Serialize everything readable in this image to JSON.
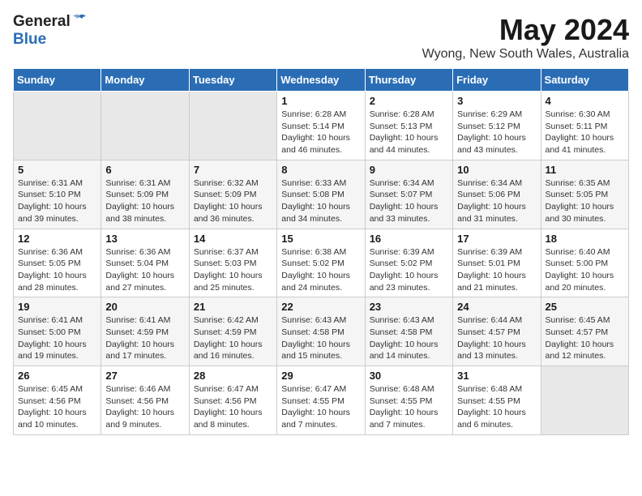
{
  "header": {
    "logo_general": "General",
    "logo_blue": "Blue",
    "month_year": "May 2024",
    "location": "Wyong, New South Wales, Australia"
  },
  "calendar": {
    "days_of_week": [
      "Sunday",
      "Monday",
      "Tuesday",
      "Wednesday",
      "Thursday",
      "Friday",
      "Saturday"
    ],
    "weeks": [
      [
        {
          "day": "",
          "info": ""
        },
        {
          "day": "",
          "info": ""
        },
        {
          "day": "",
          "info": ""
        },
        {
          "day": "1",
          "info": "Sunrise: 6:28 AM\nSunset: 5:14 PM\nDaylight: 10 hours\nand 46 minutes."
        },
        {
          "day": "2",
          "info": "Sunrise: 6:28 AM\nSunset: 5:13 PM\nDaylight: 10 hours\nand 44 minutes."
        },
        {
          "day": "3",
          "info": "Sunrise: 6:29 AM\nSunset: 5:12 PM\nDaylight: 10 hours\nand 43 minutes."
        },
        {
          "day": "4",
          "info": "Sunrise: 6:30 AM\nSunset: 5:11 PM\nDaylight: 10 hours\nand 41 minutes."
        }
      ],
      [
        {
          "day": "5",
          "info": "Sunrise: 6:31 AM\nSunset: 5:10 PM\nDaylight: 10 hours\nand 39 minutes."
        },
        {
          "day": "6",
          "info": "Sunrise: 6:31 AM\nSunset: 5:09 PM\nDaylight: 10 hours\nand 38 minutes."
        },
        {
          "day": "7",
          "info": "Sunrise: 6:32 AM\nSunset: 5:09 PM\nDaylight: 10 hours\nand 36 minutes."
        },
        {
          "day": "8",
          "info": "Sunrise: 6:33 AM\nSunset: 5:08 PM\nDaylight: 10 hours\nand 34 minutes."
        },
        {
          "day": "9",
          "info": "Sunrise: 6:34 AM\nSunset: 5:07 PM\nDaylight: 10 hours\nand 33 minutes."
        },
        {
          "day": "10",
          "info": "Sunrise: 6:34 AM\nSunset: 5:06 PM\nDaylight: 10 hours\nand 31 minutes."
        },
        {
          "day": "11",
          "info": "Sunrise: 6:35 AM\nSunset: 5:05 PM\nDaylight: 10 hours\nand 30 minutes."
        }
      ],
      [
        {
          "day": "12",
          "info": "Sunrise: 6:36 AM\nSunset: 5:05 PM\nDaylight: 10 hours\nand 28 minutes."
        },
        {
          "day": "13",
          "info": "Sunrise: 6:36 AM\nSunset: 5:04 PM\nDaylight: 10 hours\nand 27 minutes."
        },
        {
          "day": "14",
          "info": "Sunrise: 6:37 AM\nSunset: 5:03 PM\nDaylight: 10 hours\nand 25 minutes."
        },
        {
          "day": "15",
          "info": "Sunrise: 6:38 AM\nSunset: 5:02 PM\nDaylight: 10 hours\nand 24 minutes."
        },
        {
          "day": "16",
          "info": "Sunrise: 6:39 AM\nSunset: 5:02 PM\nDaylight: 10 hours\nand 23 minutes."
        },
        {
          "day": "17",
          "info": "Sunrise: 6:39 AM\nSunset: 5:01 PM\nDaylight: 10 hours\nand 21 minutes."
        },
        {
          "day": "18",
          "info": "Sunrise: 6:40 AM\nSunset: 5:00 PM\nDaylight: 10 hours\nand 20 minutes."
        }
      ],
      [
        {
          "day": "19",
          "info": "Sunrise: 6:41 AM\nSunset: 5:00 PM\nDaylight: 10 hours\nand 19 minutes."
        },
        {
          "day": "20",
          "info": "Sunrise: 6:41 AM\nSunset: 4:59 PM\nDaylight: 10 hours\nand 17 minutes."
        },
        {
          "day": "21",
          "info": "Sunrise: 6:42 AM\nSunset: 4:59 PM\nDaylight: 10 hours\nand 16 minutes."
        },
        {
          "day": "22",
          "info": "Sunrise: 6:43 AM\nSunset: 4:58 PM\nDaylight: 10 hours\nand 15 minutes."
        },
        {
          "day": "23",
          "info": "Sunrise: 6:43 AM\nSunset: 4:58 PM\nDaylight: 10 hours\nand 14 minutes."
        },
        {
          "day": "24",
          "info": "Sunrise: 6:44 AM\nSunset: 4:57 PM\nDaylight: 10 hours\nand 13 minutes."
        },
        {
          "day": "25",
          "info": "Sunrise: 6:45 AM\nSunset: 4:57 PM\nDaylight: 10 hours\nand 12 minutes."
        }
      ],
      [
        {
          "day": "26",
          "info": "Sunrise: 6:45 AM\nSunset: 4:56 PM\nDaylight: 10 hours\nand 10 minutes."
        },
        {
          "day": "27",
          "info": "Sunrise: 6:46 AM\nSunset: 4:56 PM\nDaylight: 10 hours\nand 9 minutes."
        },
        {
          "day": "28",
          "info": "Sunrise: 6:47 AM\nSunset: 4:56 PM\nDaylight: 10 hours\nand 8 minutes."
        },
        {
          "day": "29",
          "info": "Sunrise: 6:47 AM\nSunset: 4:55 PM\nDaylight: 10 hours\nand 7 minutes."
        },
        {
          "day": "30",
          "info": "Sunrise: 6:48 AM\nSunset: 4:55 PM\nDaylight: 10 hours\nand 7 minutes."
        },
        {
          "day": "31",
          "info": "Sunrise: 6:48 AM\nSunset: 4:55 PM\nDaylight: 10 hours\nand 6 minutes."
        },
        {
          "day": "",
          "info": ""
        }
      ]
    ]
  }
}
